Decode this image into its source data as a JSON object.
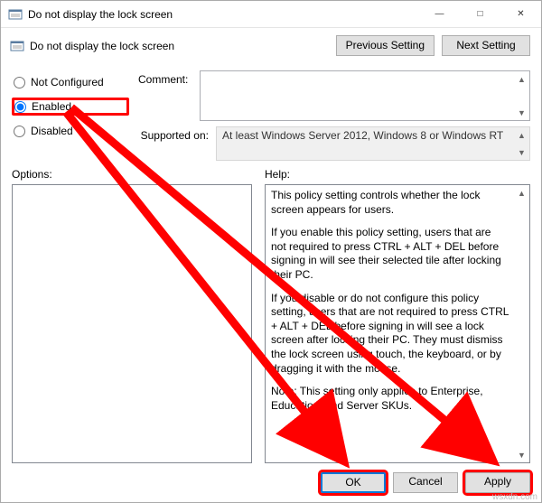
{
  "window": {
    "title": "Do not display the lock screen"
  },
  "header": {
    "policy_name": "Do not display the lock screen",
    "prev_label": "Previous Setting",
    "next_label": "Next Setting"
  },
  "radios": {
    "not_configured": "Not Configured",
    "enabled": "Enabled",
    "disabled": "Disabled",
    "selected": "enabled"
  },
  "comment": {
    "label": "Comment:",
    "value": ""
  },
  "supported": {
    "label": "Supported on:",
    "value": "At least Windows Server 2012, Windows 8 or Windows RT"
  },
  "options_label": "Options:",
  "help_label": "Help:",
  "help_paragraphs": [
    "This policy setting controls whether the lock screen appears for users.",
    "If you enable this policy setting, users that are not required to press CTRL + ALT + DEL before signing in will see their selected tile after locking their PC.",
    "If you disable or do not configure this policy setting, users that are not required to press CTRL + ALT + DEL before signing in will see a lock screen after locking their PC. They must dismiss the lock screen using touch, the keyboard, or by dragging it with the mouse.",
    "Note: This setting only applies to Enterprise, Education, and Server SKUs."
  ],
  "buttons": {
    "ok": "OK",
    "cancel": "Cancel",
    "apply": "Apply"
  },
  "watermark": "wsxdn.com"
}
